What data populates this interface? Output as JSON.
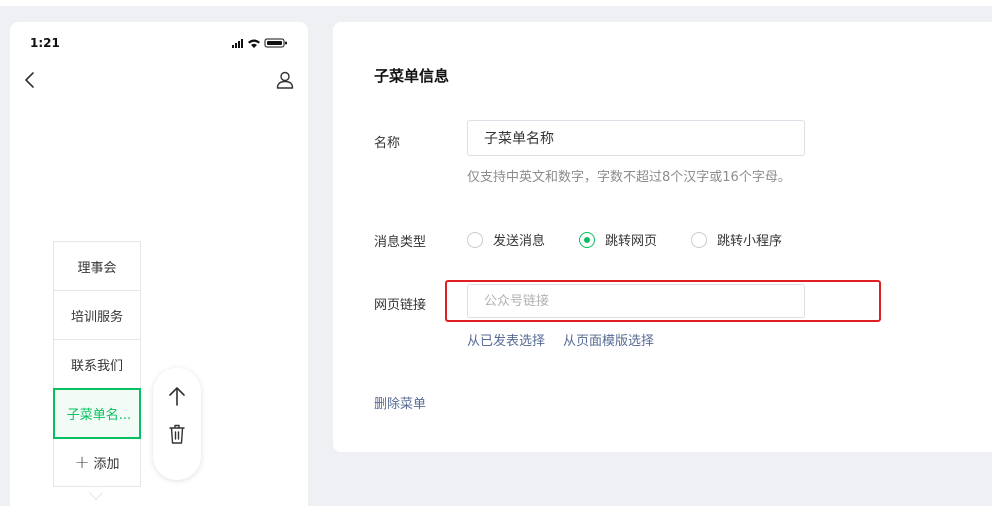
{
  "phone": {
    "status_time": "1:21",
    "icons": {
      "signal": "signal-icon",
      "wifi": "wifi-icon",
      "battery": "battery-icon",
      "back": "chevron-left-icon",
      "profile": "user-icon"
    },
    "menu_items": [
      {
        "label": "理事会"
      },
      {
        "label": "培训服务"
      },
      {
        "label": "联系我们"
      },
      {
        "label": "子菜单名..."
      }
    ],
    "add_label": "添加",
    "actions": {
      "move_up": "arrow-up-icon",
      "delete": "trash-icon"
    }
  },
  "panel": {
    "title": "子菜单信息",
    "name_label": "名称",
    "name_value": "子菜单名称",
    "name_hint": "仅支持中英文和数字，字数不超过8个汉字或16个字母。",
    "msg_type_label": "消息类型",
    "msg_type_options": [
      {
        "label": "发送消息",
        "checked": false
      },
      {
        "label": "跳转网页",
        "checked": true
      },
      {
        "label": "跳转小程序",
        "checked": false
      }
    ],
    "url_label": "网页链接",
    "url_placeholder": "公众号链接",
    "url_value": "",
    "link_published": "从已发表选择",
    "link_template": "从页面模版选择",
    "delete_label": "删除菜单"
  },
  "colors": {
    "accent": "#07c160",
    "link": "#576b95",
    "highlight": "#e02020"
  }
}
